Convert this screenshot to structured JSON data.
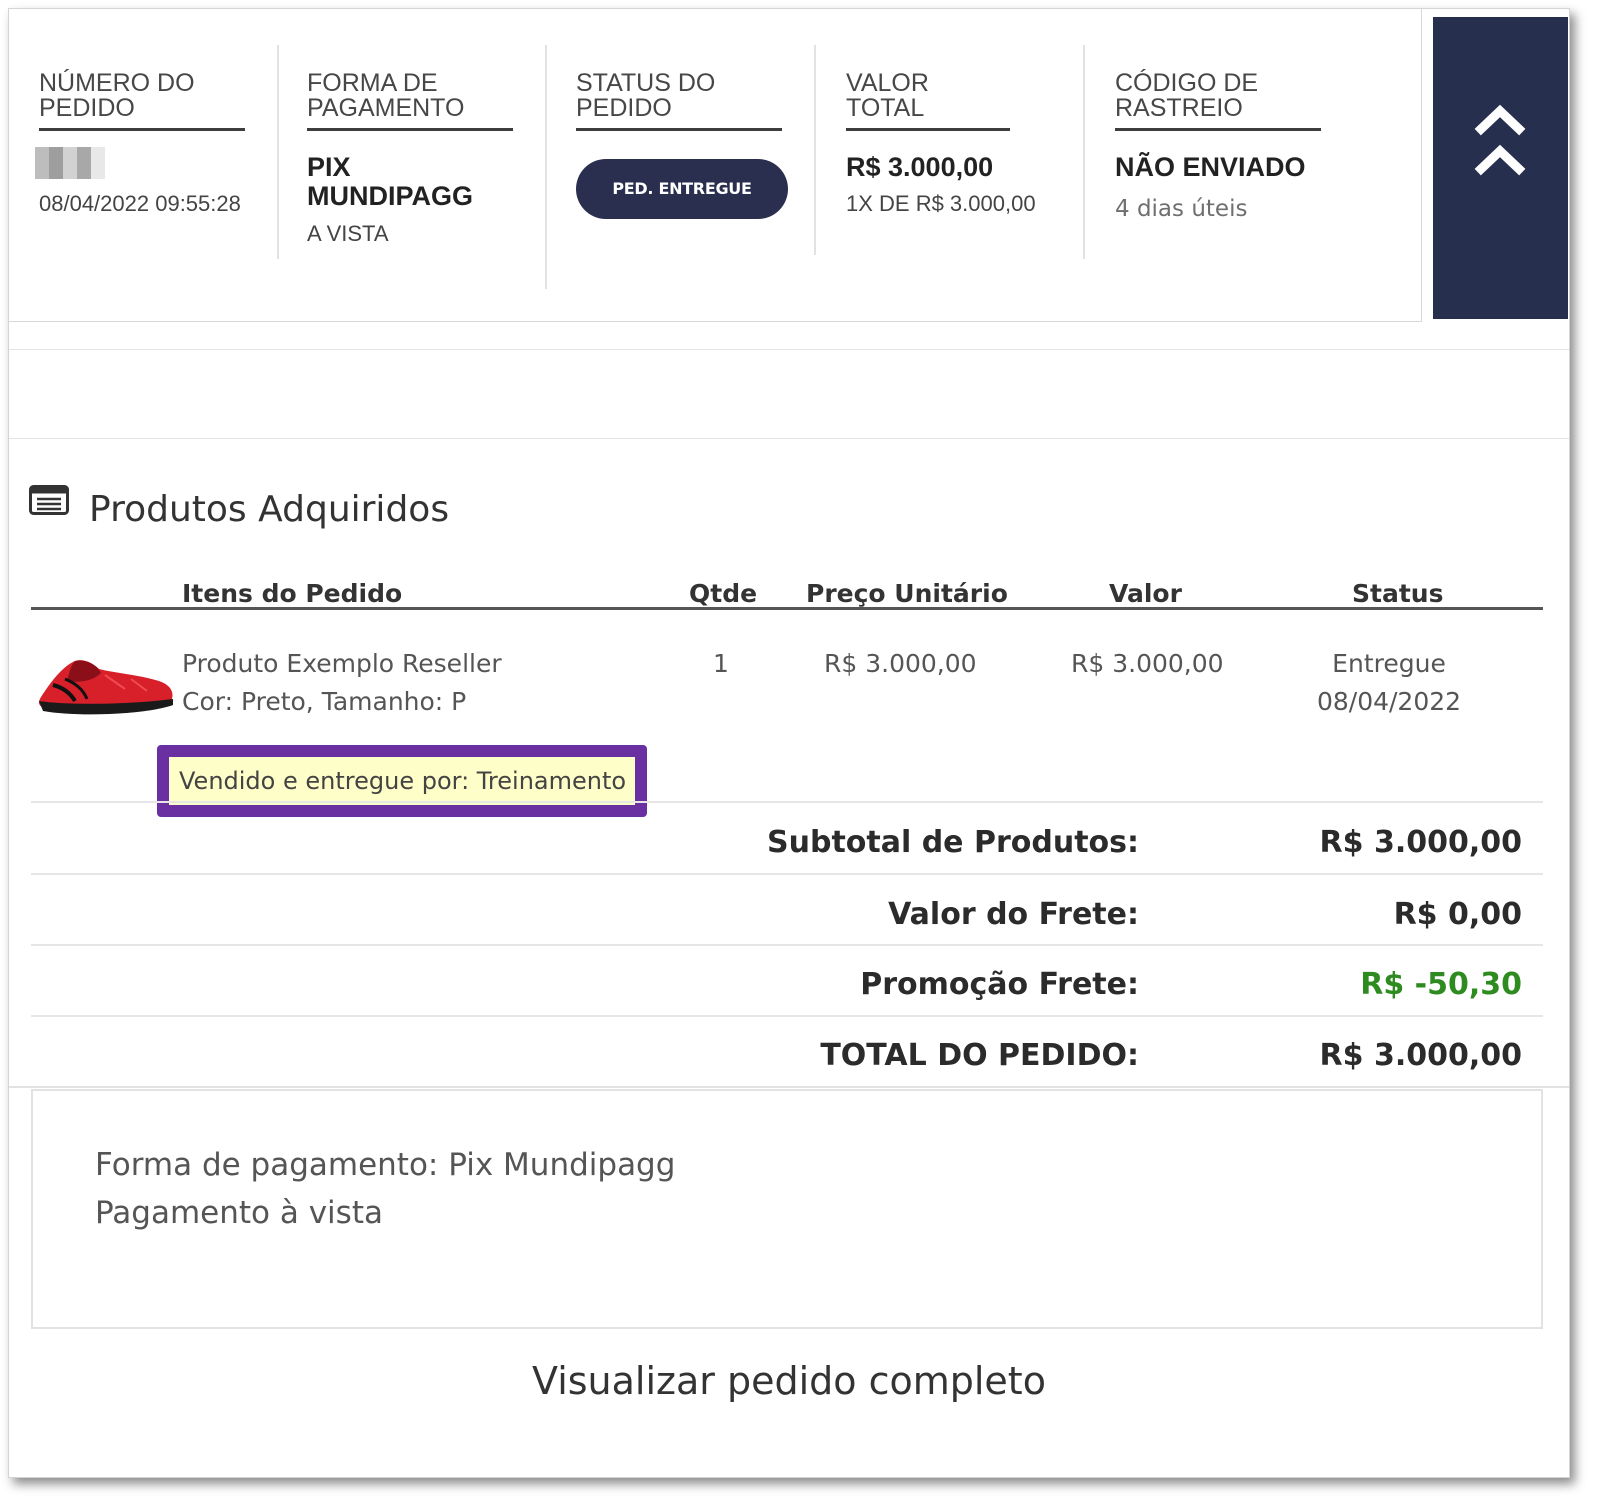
{
  "summary": {
    "order_number": {
      "label": "NÚMERO DO PEDIDO",
      "datetime": "08/04/2022 09:55:28"
    },
    "payment": {
      "label": "FORMA DE PAGAMENTO",
      "method_line1": "PIX",
      "method_line2": "MUNDIPAGG",
      "condition": "A VISTA"
    },
    "status": {
      "label": "STATUS DO PEDIDO",
      "badge": "PED. ENTREGUE"
    },
    "total": {
      "label": "VALOR TOTAL",
      "value": "R$ 3.000,00",
      "installments": "1X DE R$ 3.000,00"
    },
    "tracking": {
      "label": "CÓDIGO DE RASTREIO",
      "value": "NÃO ENVIADO",
      "eta": "4 dias úteis"
    },
    "toggle_icon": "double-chevron-up-icon"
  },
  "products": {
    "section_icon": "list-card-icon",
    "title": "Produtos Adquiridos",
    "headers": {
      "items": "Itens do Pedido",
      "qty": "Qtde",
      "unit_price": "Preço Unitário",
      "value": "Valor",
      "status": "Status"
    },
    "rows": [
      {
        "image": "red-sneaker",
        "name": "Produto Exemplo Reseller",
        "variant": "Cor: Preto, Tamanho: P",
        "qty": "1",
        "unit_price": "R$ 3.000,00",
        "value": "R$ 3.000,00",
        "status": "Entregue",
        "status_date": "08/04/2022",
        "seller": "Vendido e entregue por: Treinamento"
      }
    ]
  },
  "totals": {
    "subtotal_label": "Subtotal de Produtos:",
    "subtotal_value": "R$ 3.000,00",
    "shipping_label": "Valor do Frete:",
    "shipping_value": "R$ 0,00",
    "promo_label": "Promoção Frete:",
    "promo_value": "R$ -50,30",
    "total_label": "TOTAL DO PEDIDO:",
    "total_value": "R$ 3.000,00"
  },
  "payment_info": {
    "line1": "Forma de pagamento: Pix Mundipagg",
    "line2": "Pagamento à vista"
  },
  "view_full_order": "Visualizar pedido completo",
  "colors": {
    "navy": "#272f4f",
    "highlight_border": "#6a2fa0",
    "highlight_fill": "#fefec8",
    "discount_green": "#2e8b1f"
  }
}
